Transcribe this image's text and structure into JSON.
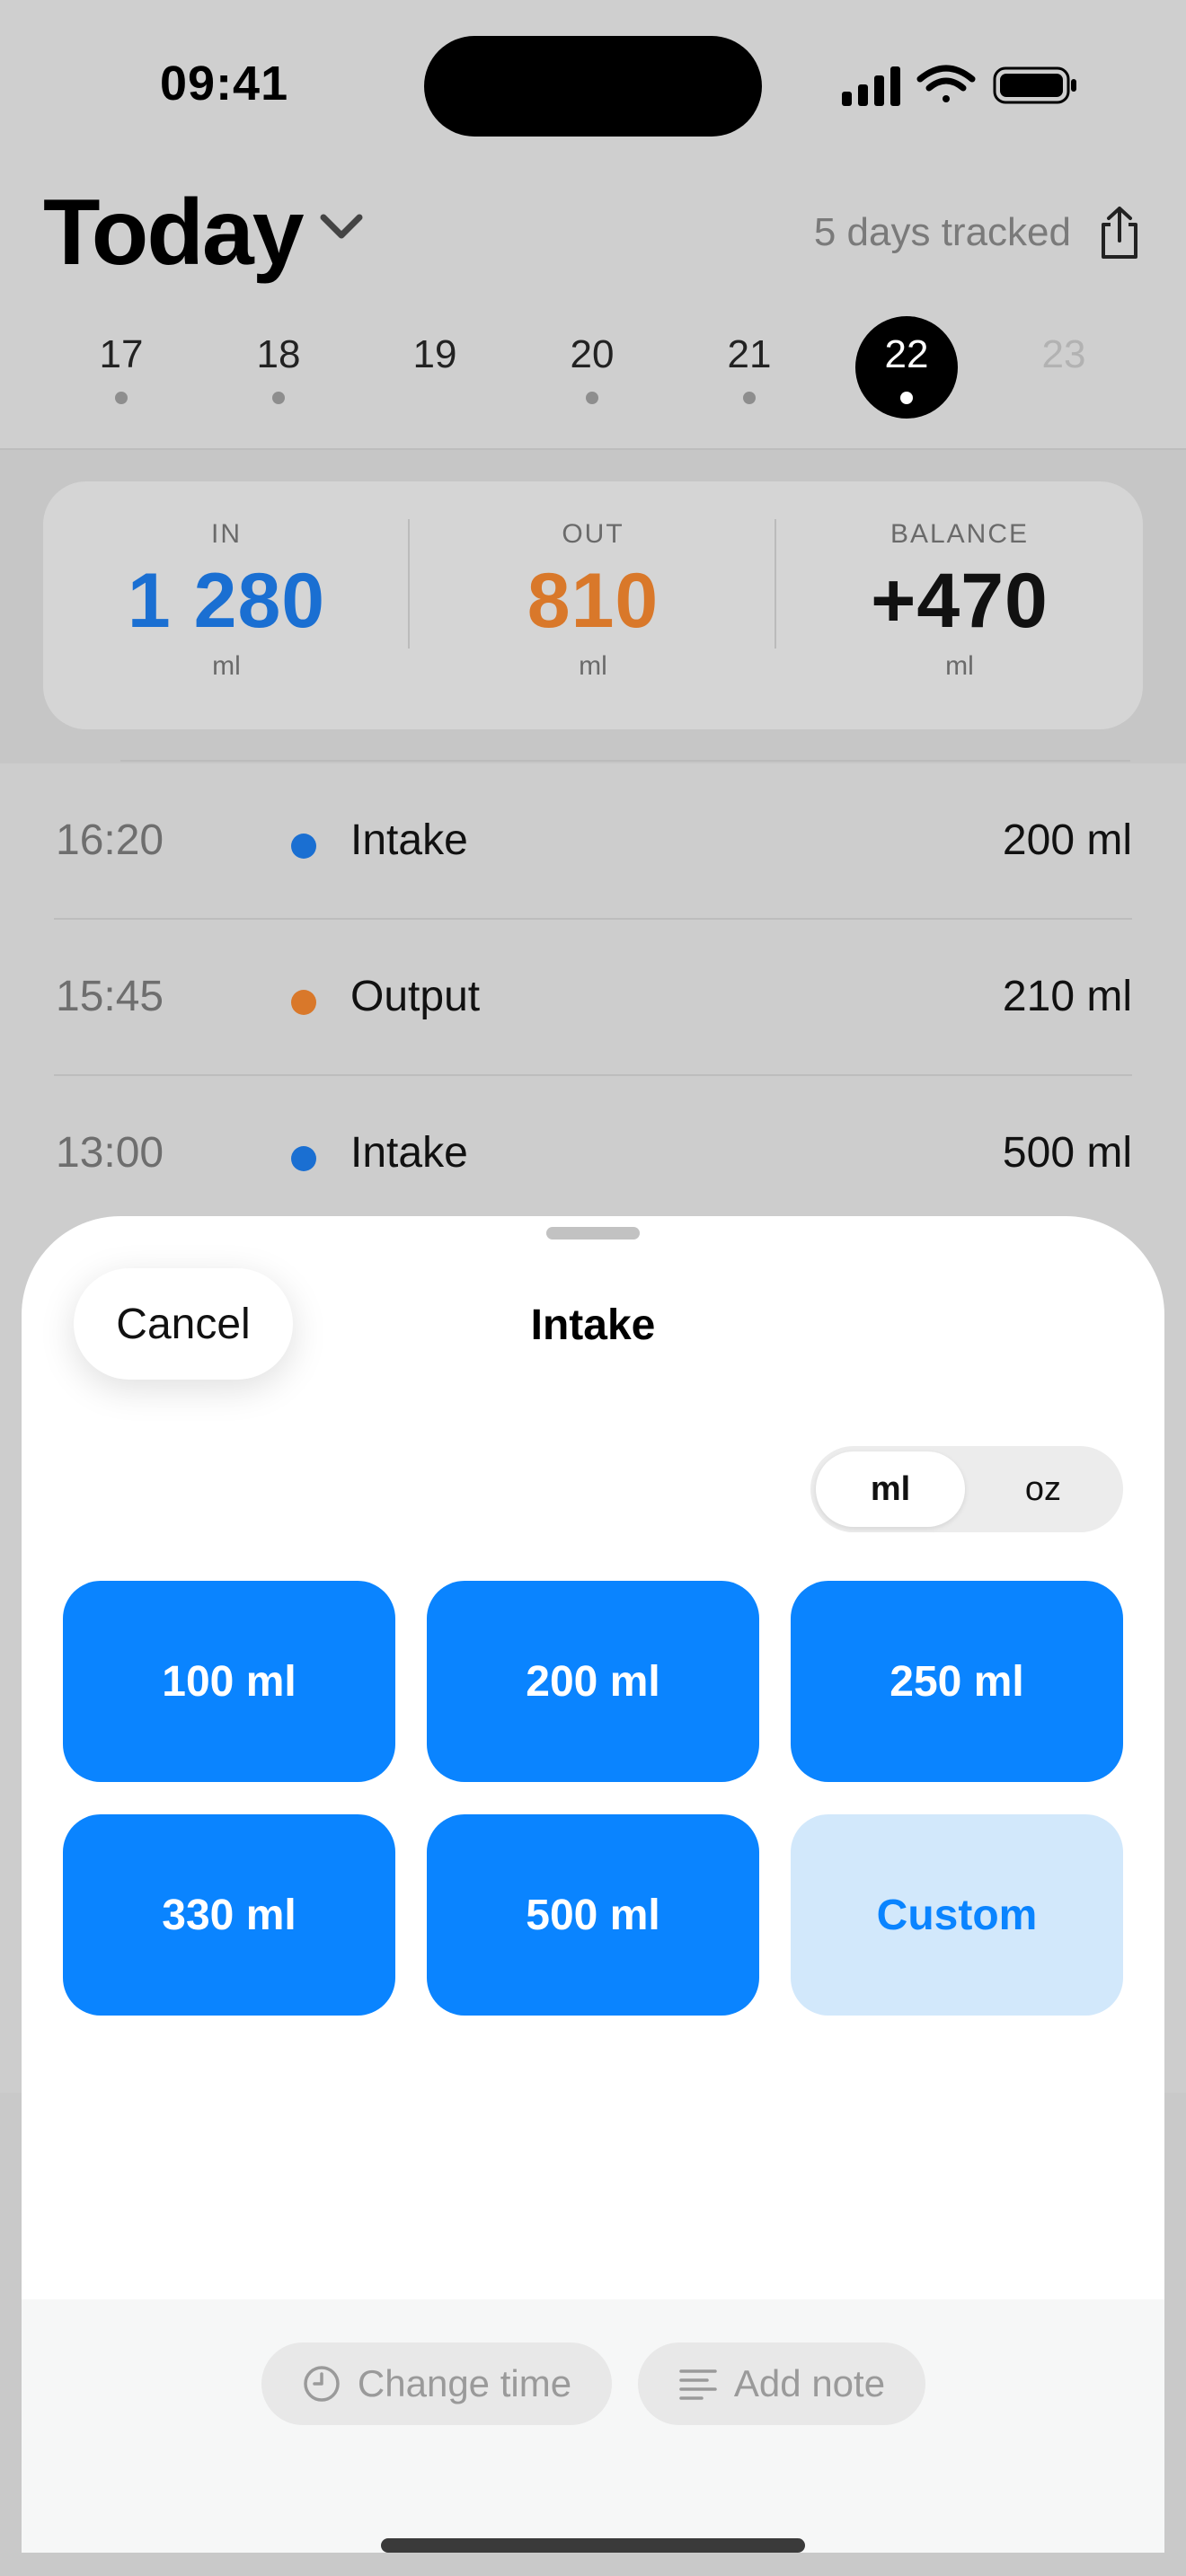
{
  "status_bar": {
    "time": "09:41"
  },
  "header": {
    "title": "Today",
    "tracked_label": "5 days tracked"
  },
  "days": [
    {
      "label": "17",
      "has_data": true
    },
    {
      "label": "18",
      "has_data": true
    },
    {
      "label": "19",
      "has_data": false
    },
    {
      "label": "20",
      "has_data": true
    },
    {
      "label": "21",
      "has_data": true
    },
    {
      "label": "22",
      "has_data": true,
      "selected": true
    },
    {
      "label": "23",
      "has_data": false,
      "future": true
    }
  ],
  "summary": {
    "in": {
      "label": "IN",
      "value": "1 280",
      "unit": "ml",
      "color": "#1a6fd2"
    },
    "out": {
      "label": "OUT",
      "value": "810",
      "unit": "ml",
      "color": "#d9782a"
    },
    "balance": {
      "label": "BALANCE",
      "value": "+470",
      "unit": "ml",
      "color": "#111111"
    }
  },
  "entries": [
    {
      "time": "16:20",
      "type": "Intake",
      "amount": "200 ml",
      "color": "#1a6fd2"
    },
    {
      "time": "15:45",
      "type": "Output",
      "amount": "210 ml",
      "color": "#d9782a"
    },
    {
      "time": "13:00",
      "type": "Intake",
      "amount": "500 ml",
      "color": "#1a6fd2"
    }
  ],
  "sheet": {
    "cancel_label": "Cancel",
    "title": "Intake",
    "units": {
      "ml": "ml",
      "oz": "oz",
      "selected": "ml"
    },
    "presets": [
      "100 ml",
      "200 ml",
      "250 ml",
      "330 ml",
      "500 ml"
    ],
    "custom_label": "Custom",
    "change_time_label": "Change time",
    "add_note_label": "Add note"
  }
}
